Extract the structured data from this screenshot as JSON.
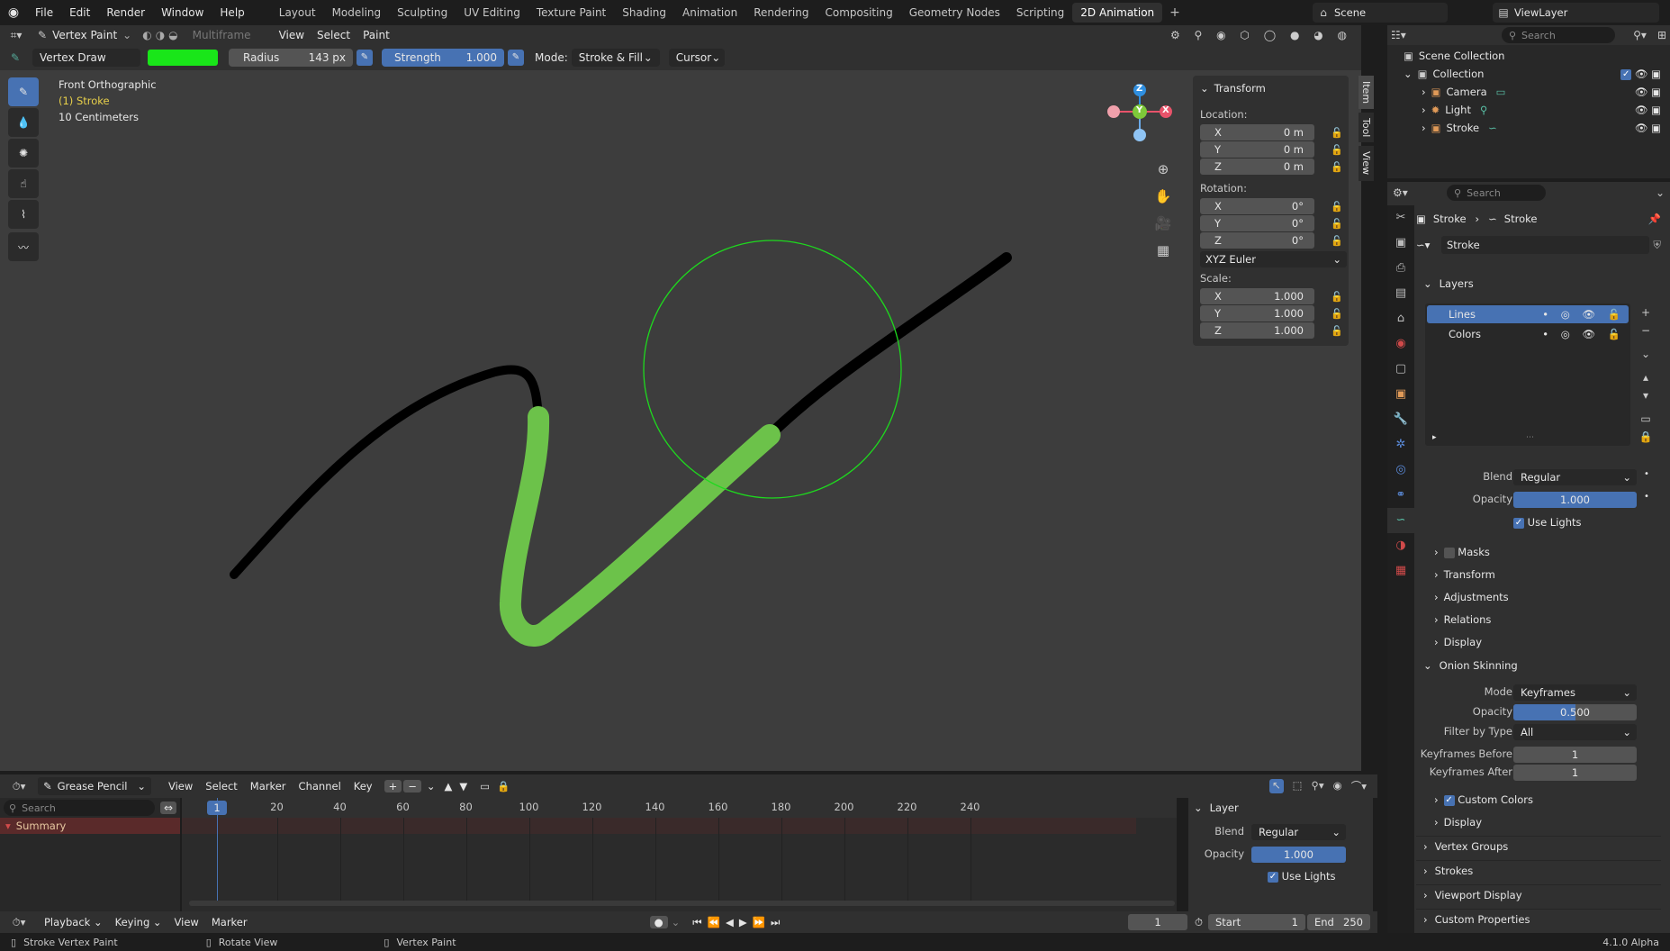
{
  "menu": {
    "file": "File",
    "edit": "Edit",
    "render": "Render",
    "window": "Window",
    "help": "Help"
  },
  "workspaces": [
    "Layout",
    "Modeling",
    "Sculpting",
    "UV Editing",
    "Texture Paint",
    "Shading",
    "Animation",
    "Rendering",
    "Compositing",
    "Geometry Nodes",
    "Scripting",
    "2D Animation"
  ],
  "active_workspace": "2D Animation",
  "scene": {
    "name": "Scene",
    "view_layer": "ViewLayer"
  },
  "viewport_header": {
    "mode": "Vertex Paint",
    "multiframe": "Multiframe",
    "view": "View",
    "select": "Select",
    "paint": "Paint"
  },
  "tool_settings": {
    "brush": "Vertex Draw",
    "color": "#19e619",
    "radius_label": "Radius",
    "radius_value": "143 px",
    "strength_label": "Strength",
    "strength_value": "1.000",
    "mode_label": "Mode:",
    "mode_value": "Stroke & Fill",
    "cursor": "Cursor"
  },
  "viewport_overlay": {
    "view_name": "Front Orthographic",
    "object": "(1) Stroke",
    "scale": "10 Centimeters"
  },
  "gizmo": {
    "z": "Z",
    "y": "Y",
    "x": "X"
  },
  "npanel": {
    "title": "Transform",
    "location_label": "Location:",
    "location": [
      {
        "axis": "X",
        "value": "0 m"
      },
      {
        "axis": "Y",
        "value": "0 m"
      },
      {
        "axis": "Z",
        "value": "0 m"
      }
    ],
    "rotation_label": "Rotation:",
    "rotation": [
      {
        "axis": "X",
        "value": "0°"
      },
      {
        "axis": "Y",
        "value": "0°"
      },
      {
        "axis": "Z",
        "value": "0°"
      }
    ],
    "rotation_mode": "XYZ Euler",
    "scale_label": "Scale:",
    "scale": [
      {
        "axis": "X",
        "value": "1.000"
      },
      {
        "axis": "Y",
        "value": "1.000"
      },
      {
        "axis": "Z",
        "value": "1.000"
      }
    ],
    "tabs": [
      "Item",
      "Tool",
      "View"
    ]
  },
  "outliner": {
    "search_placeholder": "Search",
    "root": "Scene Collection",
    "collection": "Collection",
    "items": [
      "Camera",
      "Light",
      "Stroke"
    ]
  },
  "properties": {
    "search_placeholder": "Search",
    "breadcrumb": [
      "Stroke",
      "Stroke"
    ],
    "datablock": "Stroke",
    "layers_title": "Layers",
    "layers": [
      "Lines",
      "Colors"
    ],
    "blend_label": "Blend",
    "blend_value": "Regular",
    "opacity_label": "Opacity",
    "opacity_value": "1.000",
    "use_lights": "Use Lights",
    "subsections": [
      "Masks",
      "Transform",
      "Adjustments",
      "Relations",
      "Display"
    ],
    "onion_title": "Onion Skinning",
    "onion_mode_label": "Mode",
    "onion_mode_value": "Keyframes",
    "onion_opacity_label": "Opacity",
    "onion_opacity_value": "0.500",
    "onion_opacity_fraction": 0.5,
    "filter_label": "Filter by Type",
    "filter_value": "All",
    "kf_before_label": "Keyframes Before",
    "kf_before_value": "1",
    "kf_after_label": "Keyframes After",
    "kf_after_value": "1",
    "custom_colors": "Custom Colors",
    "onion_display": "Display",
    "bottom_sections": [
      "Vertex Groups",
      "Strokes",
      "Viewport Display",
      "Custom Properties"
    ]
  },
  "timeline": {
    "mode": "Grease Pencil",
    "menus": [
      "View",
      "Select",
      "Marker",
      "Channel",
      "Key"
    ],
    "search_placeholder": "Search",
    "summary": "Summary",
    "current_frame": "1",
    "ticks": [
      "20",
      "40",
      "60",
      "80",
      "100",
      "120",
      "140",
      "160",
      "180",
      "200",
      "220",
      "240"
    ],
    "layer_panel": {
      "title": "Layer",
      "blend_label": "Blend",
      "blend_value": "Regular",
      "opacity_label": "Opacity",
      "opacity_value": "1.000",
      "use_lights": "Use Lights"
    }
  },
  "playback_bar": {
    "playback": "Playback",
    "keying": "Keying",
    "view": "View",
    "marker": "Marker",
    "frame": "1",
    "start_label": "Start",
    "start_value": "1",
    "end_label": "End",
    "end_value": "250"
  },
  "status_bar": {
    "left": "Stroke Vertex Paint",
    "mid": "Rotate View",
    "right": "Vertex Paint",
    "version": "4.1.0 Alpha"
  },
  "colors": {
    "accent": "#4772b3",
    "stroke_green": "#6cc24a",
    "cursor_circle": "#1ed91e"
  }
}
